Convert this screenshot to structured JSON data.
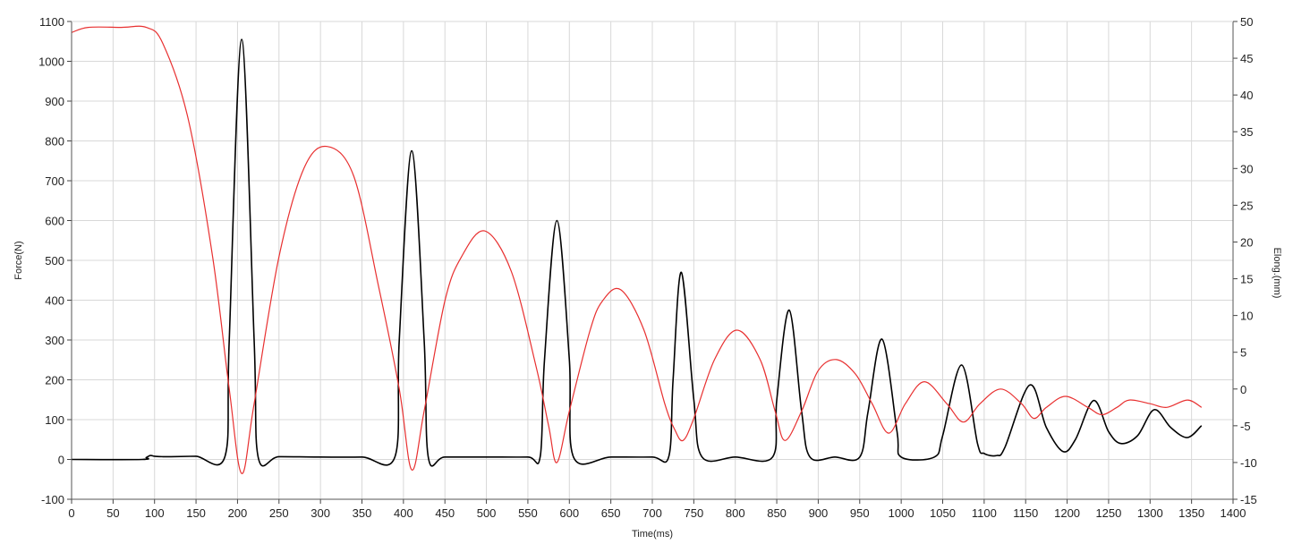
{
  "chart_data": {
    "type": "line",
    "xlabel": "Time(ms)",
    "ylabel_left": "Force(N)",
    "ylabel_right": "Elong.(mm)",
    "xlim": [
      0,
      1400
    ],
    "ylim_left": [
      -100,
      1100
    ],
    "ylim_right": [
      -15,
      50
    ],
    "x_ticks": [
      "0",
      "50",
      "100",
      "150",
      "200",
      "250",
      "300",
      "350",
      "400",
      "450",
      "500",
      "550",
      "600",
      "650",
      "700",
      "750",
      "800",
      "850",
      "900",
      "950",
      "1000",
      "1050",
      "1100",
      "1150",
      "1200",
      "1250",
      "1300",
      "1350",
      "1400"
    ],
    "y_left_ticks": [
      "-100",
      "0",
      "100",
      "200",
      "300",
      "400",
      "500",
      "600",
      "700",
      "800",
      "900",
      "1000",
      "1100"
    ],
    "y_right_ticks": [
      "-15",
      "-10",
      "-5",
      "0",
      "5",
      "10",
      "15",
      "20",
      "25",
      "30",
      "35",
      "40",
      "45",
      "50"
    ],
    "grid": true,
    "series": [
      {
        "axis": "left",
        "color": "#000000",
        "x": [
          0,
          85,
          90,
          95,
          100,
          110,
          120,
          150,
          185,
          190,
          205,
          220,
          225,
          250,
          300,
          350,
          390,
          395,
          410,
          425,
          430,
          450,
          500,
          550,
          565,
          570,
          585,
          600,
          605,
          650,
          700,
          720,
          725,
          735,
          750,
          760,
          800,
          845,
          850,
          865,
          880,
          890,
          920,
          950,
          960,
          977,
          995,
          1000,
          1040,
          1050,
          1073,
          1092,
          1100,
          1115,
          1125,
          1155,
          1175,
          1195,
          1210,
          1232,
          1250,
          1265,
          1285,
          1305,
          1325,
          1345,
          1362
        ],
        "y": [
          0,
          0,
          5,
          10,
          8,
          7,
          7,
          8,
          8,
          300,
          1055,
          300,
          5,
          7,
          6,
          6,
          8,
          300,
          775,
          300,
          5,
          6,
          6,
          6,
          8,
          250,
          600,
          250,
          6,
          6,
          6,
          8,
          200,
          470,
          150,
          6,
          6,
          6,
          150,
          375,
          120,
          6,
          6,
          6,
          120,
          302,
          70,
          6,
          6,
          60,
          237,
          40,
          15,
          10,
          30,
          187,
          80,
          20,
          50,
          148,
          70,
          40,
          60,
          125,
          80,
          55,
          85
        ]
      },
      {
        "axis": "right",
        "color": "#e83030",
        "x": [
          0,
          20,
          60,
          90,
          110,
          140,
          170,
          190,
          205,
          220,
          250,
          280,
          308,
          340,
          370,
          395,
          410,
          425,
          450,
          470,
          498,
          530,
          560,
          575,
          585,
          600,
          625,
          640,
          662,
          690,
          715,
          727,
          737,
          750,
          775,
          802,
          830,
          848,
          860,
          880,
          900,
          922,
          945,
          965,
          985,
          1005,
          1028,
          1055,
          1075,
          1095,
          1120,
          1145,
          1160,
          1175,
          1198,
          1225,
          1242,
          1260,
          1275,
          1300,
          1320,
          1345,
          1362
        ],
        "y": [
          48.5,
          49.2,
          49.2,
          49.2,
          47,
          37,
          18,
          0,
          -11.5,
          -2,
          18,
          30,
          33,
          29,
          14,
          0,
          -11,
          -3,
          12,
          18,
          21.5,
          16,
          3,
          -5,
          -10,
          -3,
          8,
          12,
          13.5,
          8,
          -2,
          -5.5,
          -7,
          -4,
          4,
          8,
          4,
          -3,
          -7,
          -3,
          2.5,
          4,
          2,
          -2,
          -6,
          -2,
          1,
          -2,
          -4.5,
          -2,
          0,
          -2,
          -4,
          -2.5,
          -1,
          -2.5,
          -3.5,
          -2.5,
          -1.5,
          -2,
          -2.5,
          -1.5,
          -2.5
        ]
      }
    ]
  }
}
